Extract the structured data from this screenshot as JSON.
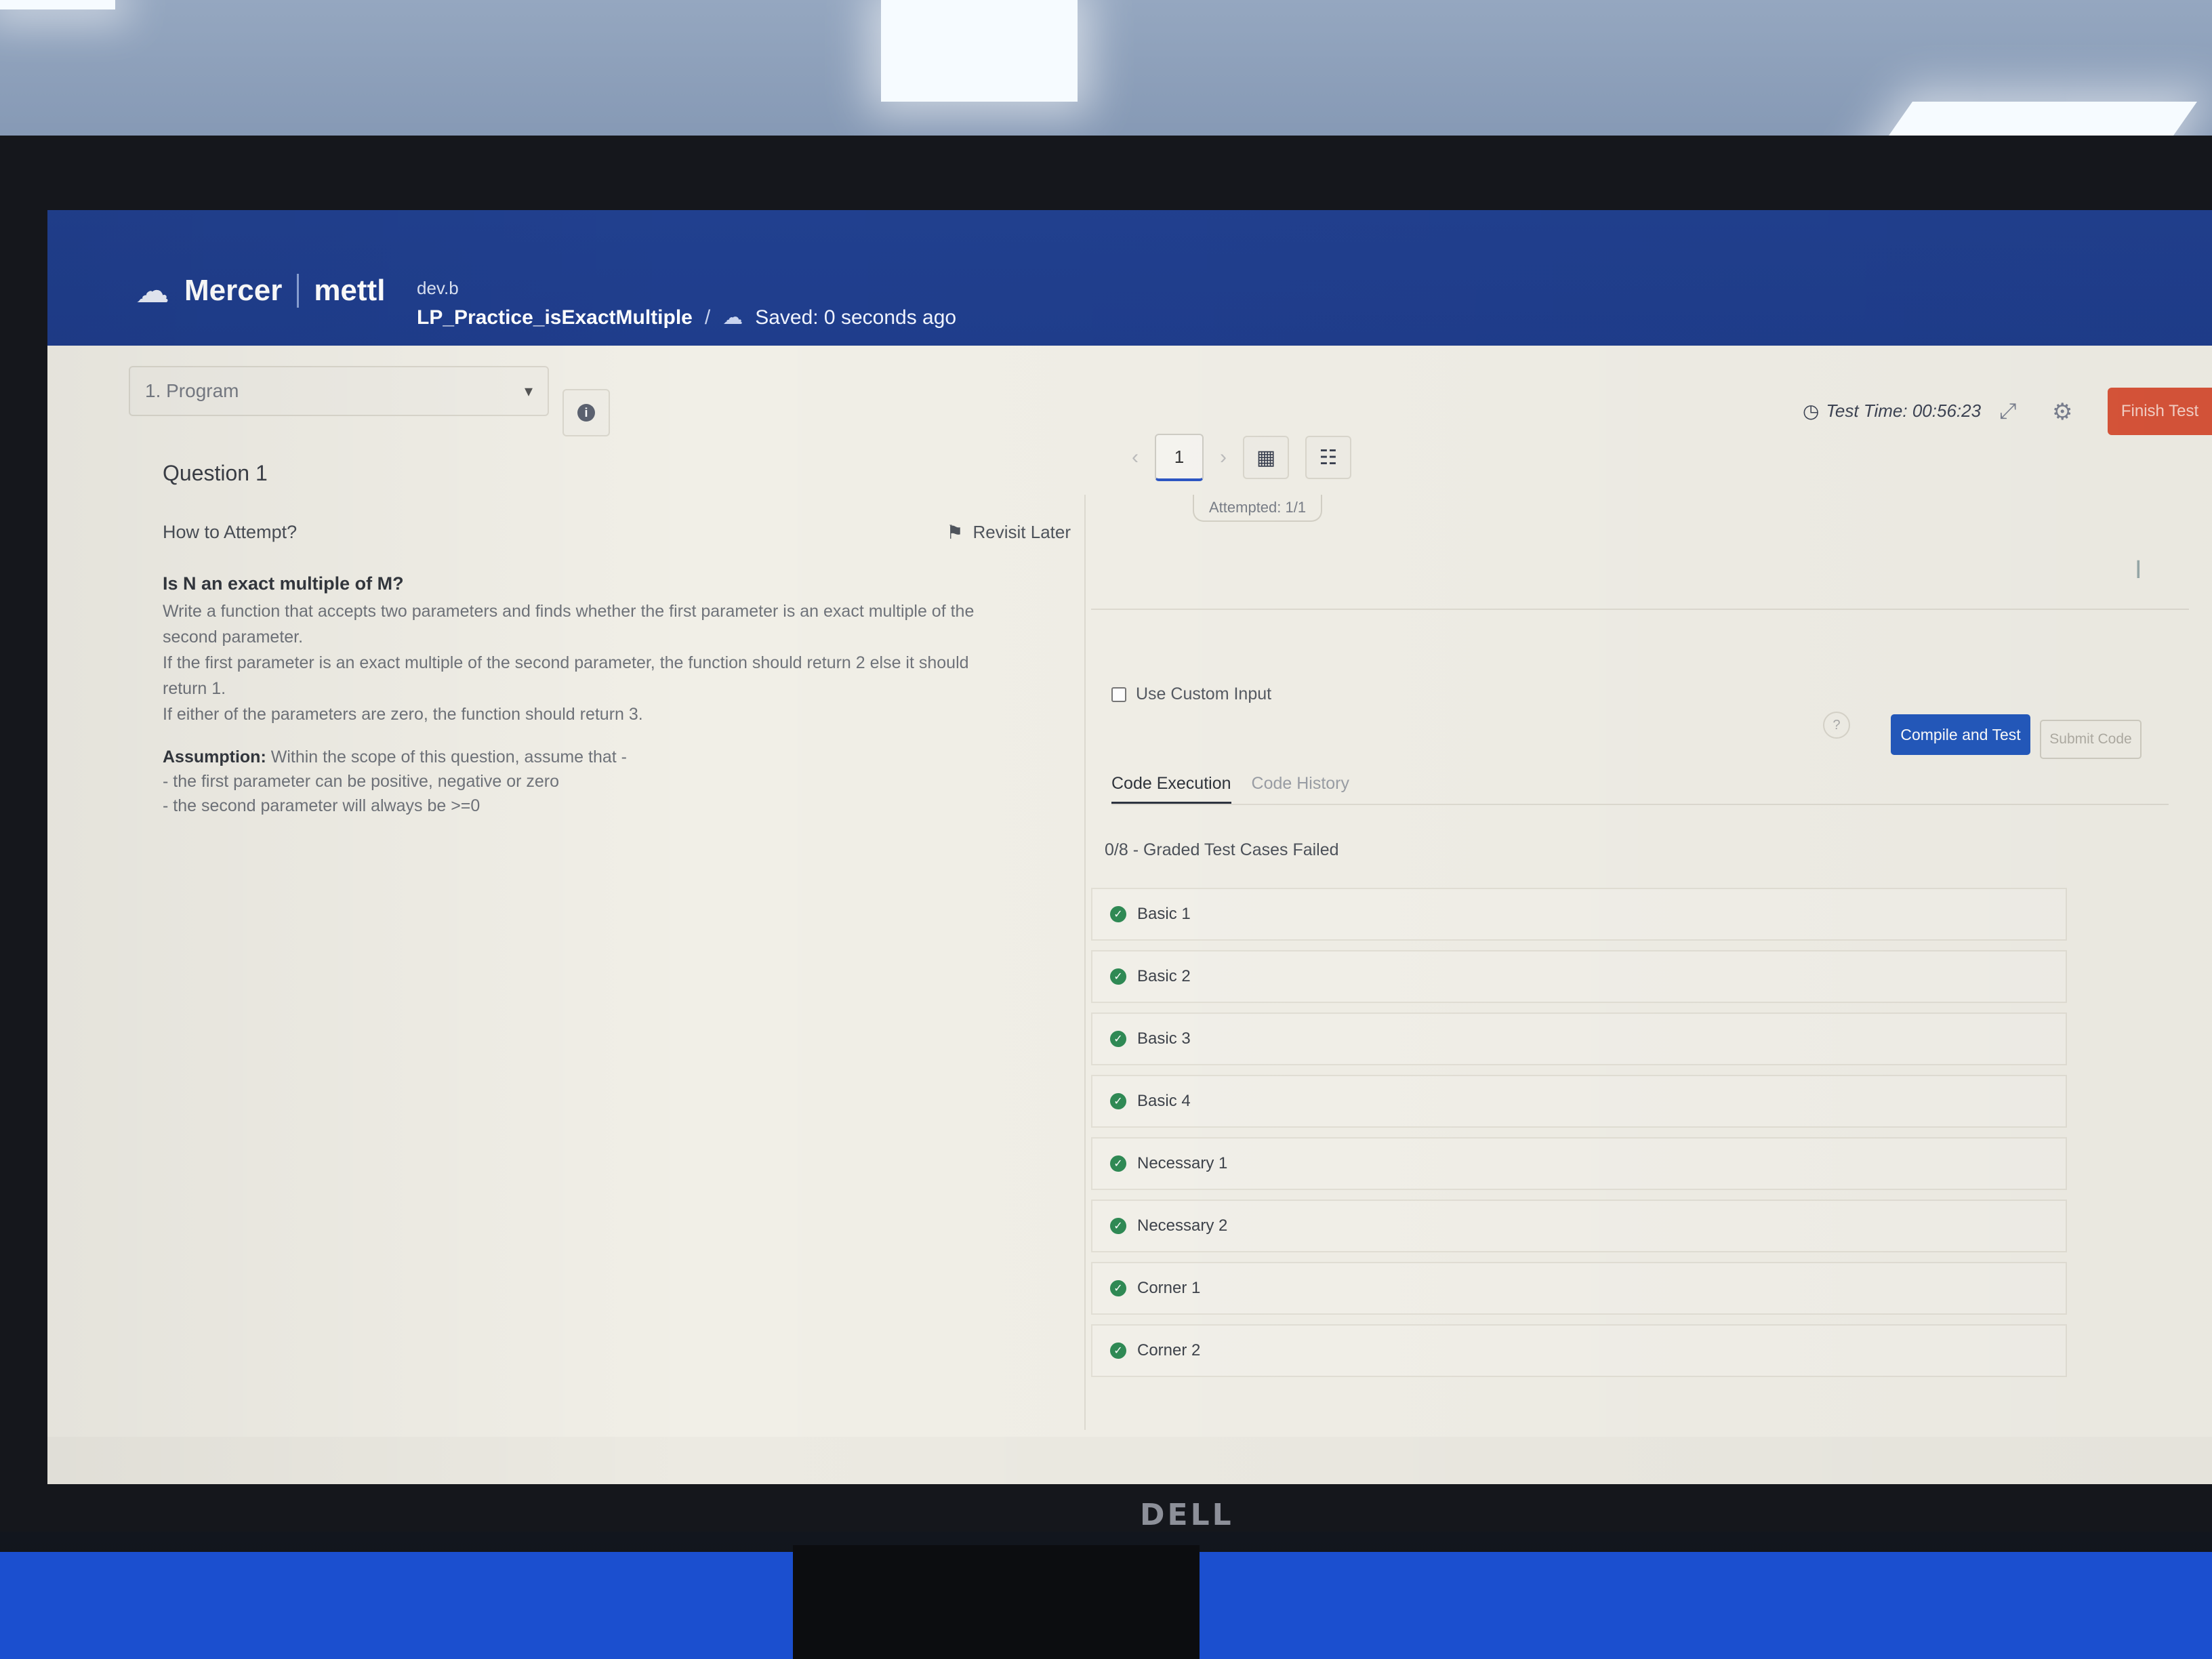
{
  "header": {
    "brand_mercer": "Mercer",
    "brand_mettl": "mettl",
    "test_owner": "dev.b",
    "test_name": "LP_Practice_isExactMultiple",
    "separator": "/",
    "saved_status": "Saved: 0 seconds ago",
    "test_time": "Test Time: 00:56:23",
    "finish_label": "Finish Test"
  },
  "section": {
    "selected": "1. Program"
  },
  "pager": {
    "current_page": "1",
    "attempted": "Attempted: 1/1"
  },
  "question": {
    "number": "Question 1",
    "how_to": "How to Attempt?",
    "revisit_label": "Revisit Later",
    "heading": "Is N an exact multiple of M?",
    "body_lines": [
      "Write a function that accepts two parameters and finds whether the first parameter is an exact multiple of the",
      "second parameter.",
      "If the first parameter is an exact multiple of the second parameter, the function should return 2 else it should",
      "return 1.",
      "If either of the parameters are zero, the function should return 3."
    ],
    "assumption_lead": "Assumption:",
    "assumption_text": " Within the scope of this question, assume that -",
    "assumption_lines": [
      "- the first parameter can be positive, negative or zero",
      "- the second parameter will always be >=0"
    ]
  },
  "execution": {
    "custom_input_label": "Use Custom Input",
    "compile_label": "Compile and Test",
    "submit_label": "Submit Code",
    "tabs": [
      "Code Execution",
      "Code History"
    ],
    "result_summary": "0/8 - Graded Test Cases Failed",
    "test_cases": [
      "Basic 1",
      "Basic 2",
      "Basic 3",
      "Basic 4",
      "Necessary 1",
      "Necessary 2",
      "Corner 1",
      "Corner 2"
    ]
  },
  "colors": {
    "header_bg": "#21408f",
    "primary_button": "#2459bd",
    "finish_button": "#d9553a",
    "pass_check": "#2f8a55"
  },
  "icons": {
    "logo": "mercer-logo-icon",
    "cloud": "cloud-icon",
    "clock": "clock-icon",
    "collapse": "collapse-icon",
    "settings": "gear-icon",
    "info": "info-icon",
    "grid": "grid-icon",
    "calculator": "calculator-icon",
    "bookmark": "bookmark-icon",
    "check": "check-circle-icon"
  }
}
